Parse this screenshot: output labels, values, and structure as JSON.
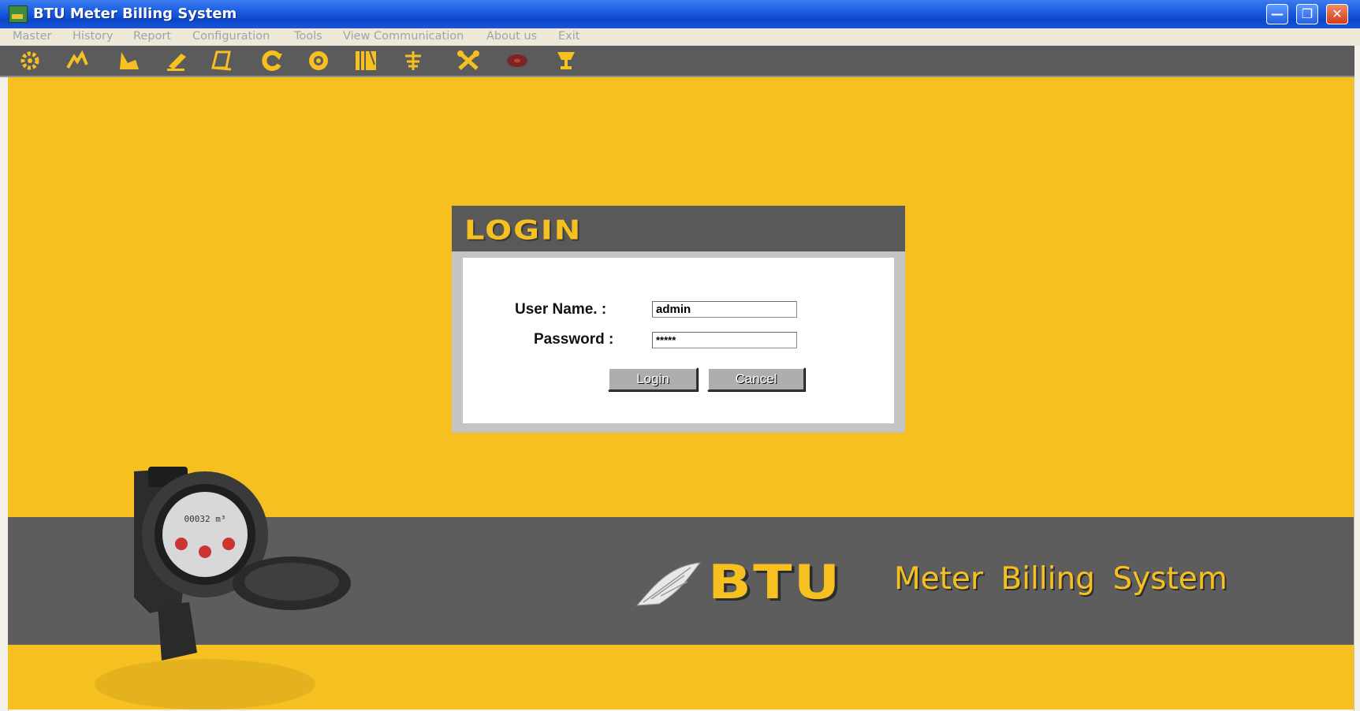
{
  "window": {
    "title": "BTU Meter Billing System",
    "controls": [
      "minimize-icon",
      "restore-icon",
      "close-icon"
    ]
  },
  "menu": [
    "Master",
    "History",
    "Report",
    "Configuration",
    "Tools",
    "View Communication",
    "About us",
    "Exit"
  ],
  "toolbar": {
    "icons": [
      "gear-icon",
      "tree-icon",
      "chart-icon",
      "pen-icon",
      "book-icon",
      "refresh-icon",
      "dial-icon",
      "records-icon",
      "settings-icon",
      "tools-icon",
      "disc-icon",
      "trophy-icon"
    ]
  },
  "login": {
    "title": "LOGIN",
    "username_label": "User Name. :",
    "username_value": "admin",
    "password_label": "Password :",
    "password_value": "*****",
    "login_label": "Login",
    "cancel_label": "Cancel"
  },
  "branding": {
    "btu": "BTU",
    "tagline": "Meter Billing System",
    "meter_dial_value": "00032 m³"
  },
  "colors": {
    "background": "#f6c021",
    "panel_dark": "#5d5d5d",
    "titlebar": "#1b5de0"
  }
}
